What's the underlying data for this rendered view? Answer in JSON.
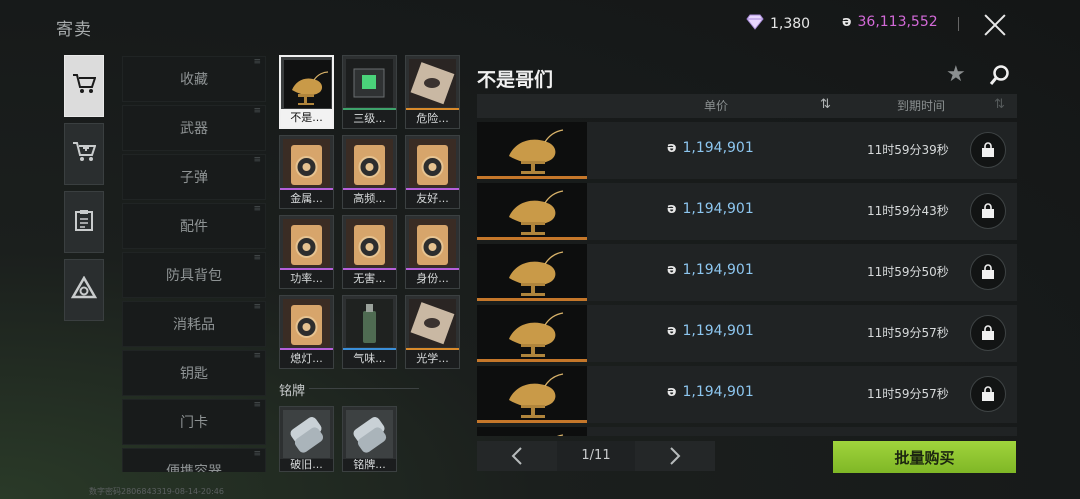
{
  "header": {
    "title": "寄卖",
    "diamond_count": "1,380",
    "coin_count": "36,113,552",
    "colors": {
      "coin": "#d36ad8",
      "price": "#8dc6ef",
      "bulk_button": "#8fc830"
    }
  },
  "rail": {
    "items": [
      {
        "icon": "cart-icon",
        "active": true
      },
      {
        "icon": "cart-add-icon",
        "active": false
      },
      {
        "icon": "clipboard-icon",
        "active": false
      },
      {
        "icon": "triangle-logo-icon",
        "active": false
      }
    ]
  },
  "categories": [
    "收藏",
    "武器",
    "子弹",
    "配件",
    "防具背包",
    "消耗品",
    "钥匙",
    "门卡",
    "便携容器"
  ],
  "items": [
    {
      "label": "不是...",
      "selected": true,
      "rarity": "orange"
    },
    {
      "label": "三级...",
      "selected": false,
      "rarity": "green"
    },
    {
      "label": "危险...",
      "selected": false,
      "rarity": "orange"
    },
    {
      "label": "金属...",
      "selected": false,
      "rarity": "purple"
    },
    {
      "label": "高频...",
      "selected": false,
      "rarity": "purple"
    },
    {
      "label": "友好...",
      "selected": false,
      "rarity": "purple"
    },
    {
      "label": "功率...",
      "selected": false,
      "rarity": "purple"
    },
    {
      "label": "无害...",
      "selected": false,
      "rarity": "purple"
    },
    {
      "label": "身份...",
      "selected": false,
      "rarity": "purple"
    },
    {
      "label": "熄灯...",
      "selected": false,
      "rarity": "purple"
    },
    {
      "label": "气味...",
      "selected": false,
      "rarity": "blue"
    },
    {
      "label": "光学...",
      "selected": false,
      "rarity": "orange"
    }
  ],
  "tags_section": {
    "label": "铭牌",
    "items": [
      {
        "label": "破旧..."
      },
      {
        "label": "铭牌..."
      }
    ]
  },
  "detail": {
    "title": "不是哥们",
    "columns": {
      "price": "单价",
      "expiry": "到期时间"
    },
    "listings": [
      {
        "price": "1,194,901",
        "time": "11时59分39秒"
      },
      {
        "price": "1,194,901",
        "time": "11时59分43秒"
      },
      {
        "price": "1,194,901",
        "time": "11时59分50秒"
      },
      {
        "price": "1,194,901",
        "time": "11时59分57秒"
      },
      {
        "price": "1,194,901",
        "time": "11时59分57秒"
      },
      {
        "price": "",
        "time": ""
      }
    ]
  },
  "pager": {
    "page": "1/11",
    "prev": "‹",
    "next": "›"
  },
  "bulk_buy": "批量购买",
  "watermark": "数字密码2806843319-08-14-20:46"
}
